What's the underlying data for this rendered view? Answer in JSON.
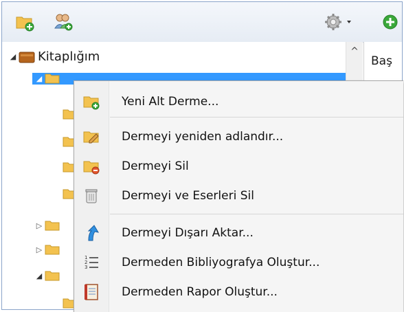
{
  "tree": {
    "root_label": "Kitaplığım"
  },
  "right_pane": {
    "header": "Baş"
  },
  "context_menu": {
    "items": [
      {
        "label": "Yeni Alt Derme...",
        "icon": "new-subcollection-icon"
      },
      {
        "label": "Dermeyi yeniden adlandır...",
        "icon": "rename-icon"
      },
      {
        "label": "Dermeyi Sil",
        "icon": "delete-collection-icon"
      },
      {
        "label": "Dermeyi ve Eserleri Sil",
        "icon": "trash-icon"
      },
      {
        "label": "Dermeyi Dışarı Aktar...",
        "icon": "export-arrow-icon"
      },
      {
        "label": "Dermeden Bibliyografya Oluştur...",
        "icon": "numbered-list-icon"
      },
      {
        "label": "Dermeden Rapor Oluştur...",
        "icon": "report-icon"
      }
    ]
  },
  "colors": {
    "selection": "#3399ff",
    "folder": "#f3c24f"
  }
}
